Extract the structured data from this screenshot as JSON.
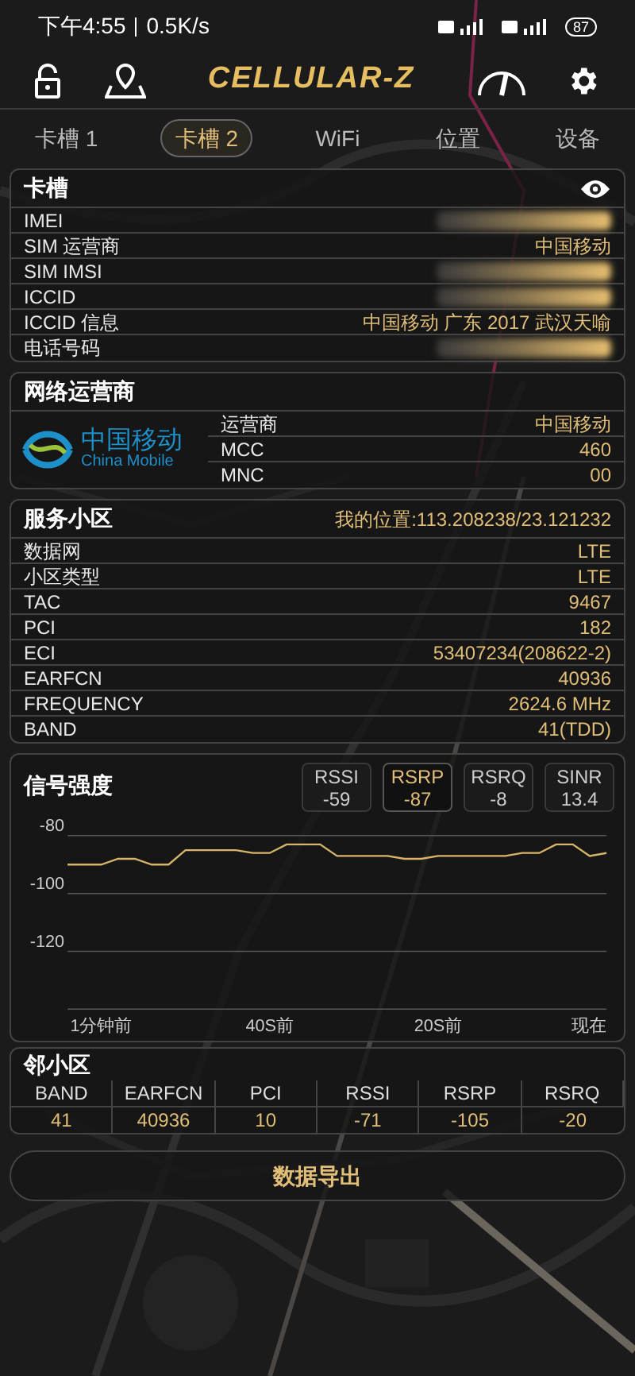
{
  "status_bar": {
    "time": "下午4:55",
    "speed": "0.5K/s",
    "battery": "87"
  },
  "header": {
    "logo": "CELLULAR-Z"
  },
  "tabs": [
    {
      "label": "卡槽 1",
      "selected": false
    },
    {
      "label": "卡槽 2",
      "selected": true
    },
    {
      "label": "WiFi",
      "selected": false
    },
    {
      "label": "位置",
      "selected": false
    },
    {
      "label": "设备",
      "selected": false
    }
  ],
  "sim_card": {
    "title": "卡槽",
    "rows": [
      {
        "label": "IMEI",
        "redacted": true
      },
      {
        "label": "SIM 运营商",
        "value": "中国移动",
        "redacted": false
      },
      {
        "label": "SIM IMSI",
        "redacted": true
      },
      {
        "label": "ICCID",
        "redacted": true
      },
      {
        "label": "ICCID 信息",
        "value": "中国移动 广东 2017 武汉天喻",
        "redacted": false
      },
      {
        "label": "电话号码",
        "redacted": true
      }
    ]
  },
  "network_operator": {
    "title": "网络运营商",
    "logo_text": "中国移动",
    "logo_subtext": "China Mobile",
    "rows": [
      {
        "label": "运营商",
        "value": "中国移动"
      },
      {
        "label": "MCC",
        "value": "460"
      },
      {
        "label": "MNC",
        "value": "00"
      }
    ]
  },
  "serving_cell": {
    "title": "服务小区",
    "location": "我的位置:113.208238/23.121232",
    "rows": [
      {
        "label": "数据网",
        "value": "LTE"
      },
      {
        "label": "小区类型",
        "value": "LTE"
      },
      {
        "label": "TAC",
        "value": "9467"
      },
      {
        "label": "PCI",
        "value": "182"
      },
      {
        "label": "ECI",
        "value": "53407234(208622-2)"
      },
      {
        "label": "EARFCN",
        "value": "40936"
      },
      {
        "label": "FREQUENCY",
        "value": "2624.6 MHz"
      },
      {
        "label": "BAND",
        "value": "41(TDD)"
      }
    ]
  },
  "signal": {
    "title": "信号强度",
    "metrics": [
      {
        "name": "RSSI",
        "value": "-59",
        "selected": false
      },
      {
        "name": "RSRP",
        "value": "-87",
        "selected": true
      },
      {
        "name": "RSRQ",
        "value": "-8",
        "selected": false
      },
      {
        "name": "SINR",
        "value": "13.4",
        "selected": false
      }
    ],
    "time_labels": [
      "1分钟前",
      "40S前",
      "20S前",
      "现在"
    ],
    "chart_data": {
      "type": "line",
      "grid": true,
      "ylim": [
        -140,
        -80
      ],
      "yticks": [
        -80,
        -100,
        -120
      ],
      "series": [
        {
          "color": "#d9b56a",
          "values": [
            -90,
            -90,
            -90,
            -88,
            -88,
            -90,
            -90,
            -85,
            -85,
            -85,
            -85,
            -86,
            -86,
            -83,
            -83,
            -83,
            -87,
            -87,
            -87,
            -87,
            -88,
            -88,
            -87,
            -87,
            -87,
            -87,
            -87,
            -86,
            -86,
            -83,
            -83,
            -87,
            -86
          ]
        }
      ]
    }
  },
  "neighbor_cells": {
    "title": "邻小区",
    "columns": [
      "BAND",
      "EARFCN",
      "PCI",
      "RSSI",
      "RSRP",
      "RSRQ"
    ],
    "rows": [
      [
        "41",
        "40936",
        "10",
        "-71",
        "-105",
        "-20"
      ]
    ]
  },
  "export_button": {
    "label": "数据导出"
  }
}
